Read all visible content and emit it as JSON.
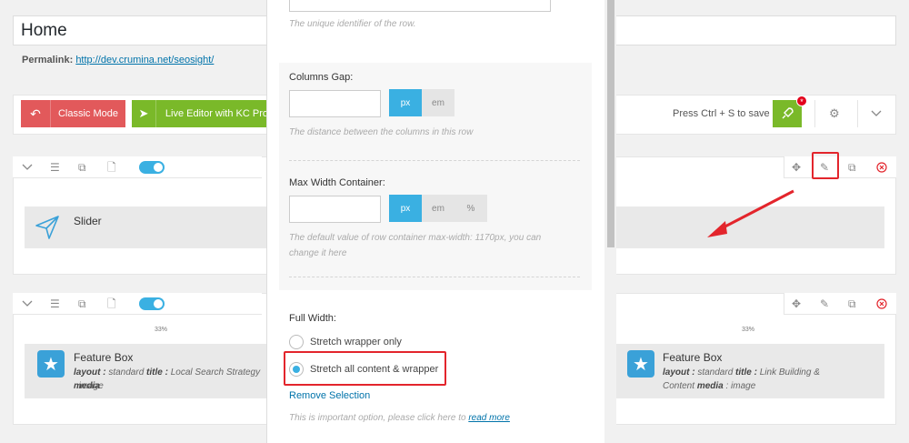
{
  "page": {
    "title": "Home",
    "permalink_label": "Permalink:",
    "permalink_url": "http://dev.crumina.net/seosight/"
  },
  "toolbar": {
    "classic_mode": "Classic Mode",
    "live_editor": "Live Editor with KC Pro",
    "save_hint": "Press Ctrl + S to save",
    "badge": "*"
  },
  "rows": [
    {
      "element": {
        "title": "Slider"
      }
    },
    {
      "columns": [
        {
          "width": "33%",
          "element": {
            "title": "Feature Box",
            "layout_key": "layout :",
            "layout_val": "standard",
            "title_key": "title :",
            "title_val": "Local Search Strategy",
            "media_key": "media",
            "media_val": ": image"
          }
        },
        {
          "width": "33%",
          "element": {
            "title": "Feature Box",
            "layout_key": "layout :",
            "layout_val": "standard",
            "title_key": "title :",
            "title_val": "Link Building &",
            "line2": "Content",
            "media_key": "media",
            "media_val": ": image"
          }
        }
      ]
    }
  ],
  "modal": {
    "row_id_help": "The unique identifier of the row.",
    "columns_gap": {
      "label": "Columns Gap:",
      "value": "",
      "units": [
        "px",
        "em"
      ],
      "active_unit": "px",
      "help": "The distance between the columns in this row"
    },
    "max_width": {
      "label": "Max Width Container:",
      "value": "",
      "units": [
        "px",
        "em",
        "%"
      ],
      "active_unit": "px",
      "help_line1": "The default value of row container max-width: 1170px, you can",
      "help_line2": "change it here"
    },
    "full_width": {
      "label": "Full Width:",
      "options": [
        "Stretch wrapper only",
        "Stretch all content & wrapper"
      ],
      "selected": "Stretch all content & wrapper",
      "remove_label": "Remove Selection",
      "help_prefix": "This is important option, please click here to",
      "help_link": "read more"
    }
  },
  "colors": {
    "accent": "#3ab0e2",
    "classic": "#e2595b",
    "live": "#7ab929",
    "highlight": "#e3252c"
  }
}
